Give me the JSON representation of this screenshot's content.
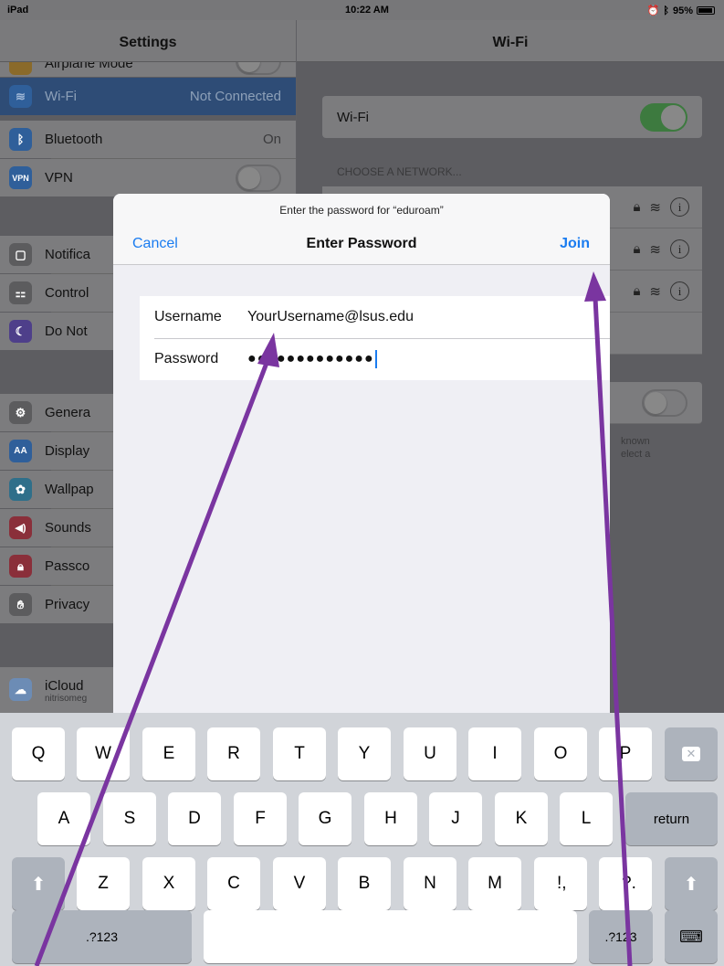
{
  "status_bar": {
    "device": "iPad",
    "time": "10:22 AM",
    "battery": "95%"
  },
  "settings": {
    "title": "Settings",
    "partial_top_label": "Airplane Mode",
    "items": [
      {
        "label": "Wi-Fi",
        "value": "Not Connected",
        "icon": "wifi-icon",
        "color": "#2f5f9a"
      },
      {
        "label": "Bluetooth",
        "value": "On",
        "icon": "bluetooth-icon",
        "color": "#2f5f9a"
      },
      {
        "label": "VPN",
        "value": "",
        "icon": "vpn-icon",
        "color": "#2f5f9a"
      },
      {
        "label": "Notifica",
        "icon": "notifications-icon",
        "color": "#5c5c5e"
      },
      {
        "label": "Control",
        "icon": "control-center-icon",
        "color": "#5c5c5e"
      },
      {
        "label": "Do Not",
        "icon": "do-not-disturb-icon",
        "color": "#4e3f8a"
      },
      {
        "label": "Genera",
        "icon": "gear-icon",
        "color": "#5c5c5e"
      },
      {
        "label": "Display",
        "icon": "display-icon",
        "color": "#2f5f9a"
      },
      {
        "label": "Wallpap",
        "icon": "wallpaper-icon",
        "color": "#2f6f8a"
      },
      {
        "label": "Sounds",
        "icon": "sounds-icon",
        "color": "#8a2f3a"
      },
      {
        "label": "Passco",
        "icon": "lock-icon",
        "color": "#8a2f3a"
      },
      {
        "label": "Privacy",
        "icon": "hand-icon",
        "color": "#5c5c5e"
      },
      {
        "label": "iCloud",
        "sublabel": "nitrisomeg",
        "icon": "cloud-icon",
        "color": "#6c8cb5"
      }
    ]
  },
  "wifi": {
    "title": "Wi-Fi",
    "toggle_label": "Wi-Fi",
    "section_header": "CHOOSE A NETWORK...",
    "ask_partial": [
      "known",
      "elect a"
    ]
  },
  "dialog": {
    "prompt": "Enter the password for “eduroam”",
    "cancel": "Cancel",
    "title": "Enter Password",
    "join": "Join",
    "username_label": "Username",
    "username_value": "YourUsername@lsus.edu",
    "password_label": "Password",
    "password_value": "●●●●●●●●●●●●●"
  },
  "keyboard": {
    "row1": [
      "Q",
      "W",
      "E",
      "R",
      "T",
      "Y",
      "U",
      "I",
      "O",
      "P"
    ],
    "row2": [
      "A",
      "S",
      "D",
      "F",
      "G",
      "H",
      "J",
      "K",
      "L"
    ],
    "row3": [
      "Z",
      "X",
      "C",
      "V",
      "B",
      "N",
      "M",
      "!,",
      "?."
    ],
    "return": "return",
    "numbers": ".?123",
    "accent_color": "#7a35a0"
  }
}
